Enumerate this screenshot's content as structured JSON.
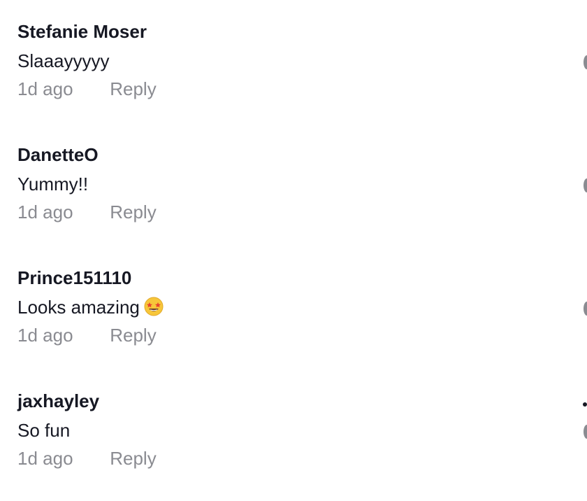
{
  "comments": [
    {
      "username": "Stefanie Moser",
      "text": "Slaaayyyyy",
      "timestamp": "1d ago",
      "reply_label": "Reply"
    },
    {
      "username": "DanetteO",
      "text": "Yummy!!",
      "timestamp": "1d ago",
      "reply_label": "Reply"
    },
    {
      "username": "Prince151110",
      "text": "Looks amazing",
      "emoji": "star-struck-emoji",
      "timestamp": "1d ago",
      "reply_label": "Reply"
    },
    {
      "username": "jaxhayley",
      "text": "So fun",
      "timestamp": "1d ago",
      "reply_label": "Reply"
    }
  ],
  "colors": {
    "username": "#161823",
    "text": "#161823",
    "meta": "#8a8b91",
    "emoji_face": "#f7c63a"
  }
}
